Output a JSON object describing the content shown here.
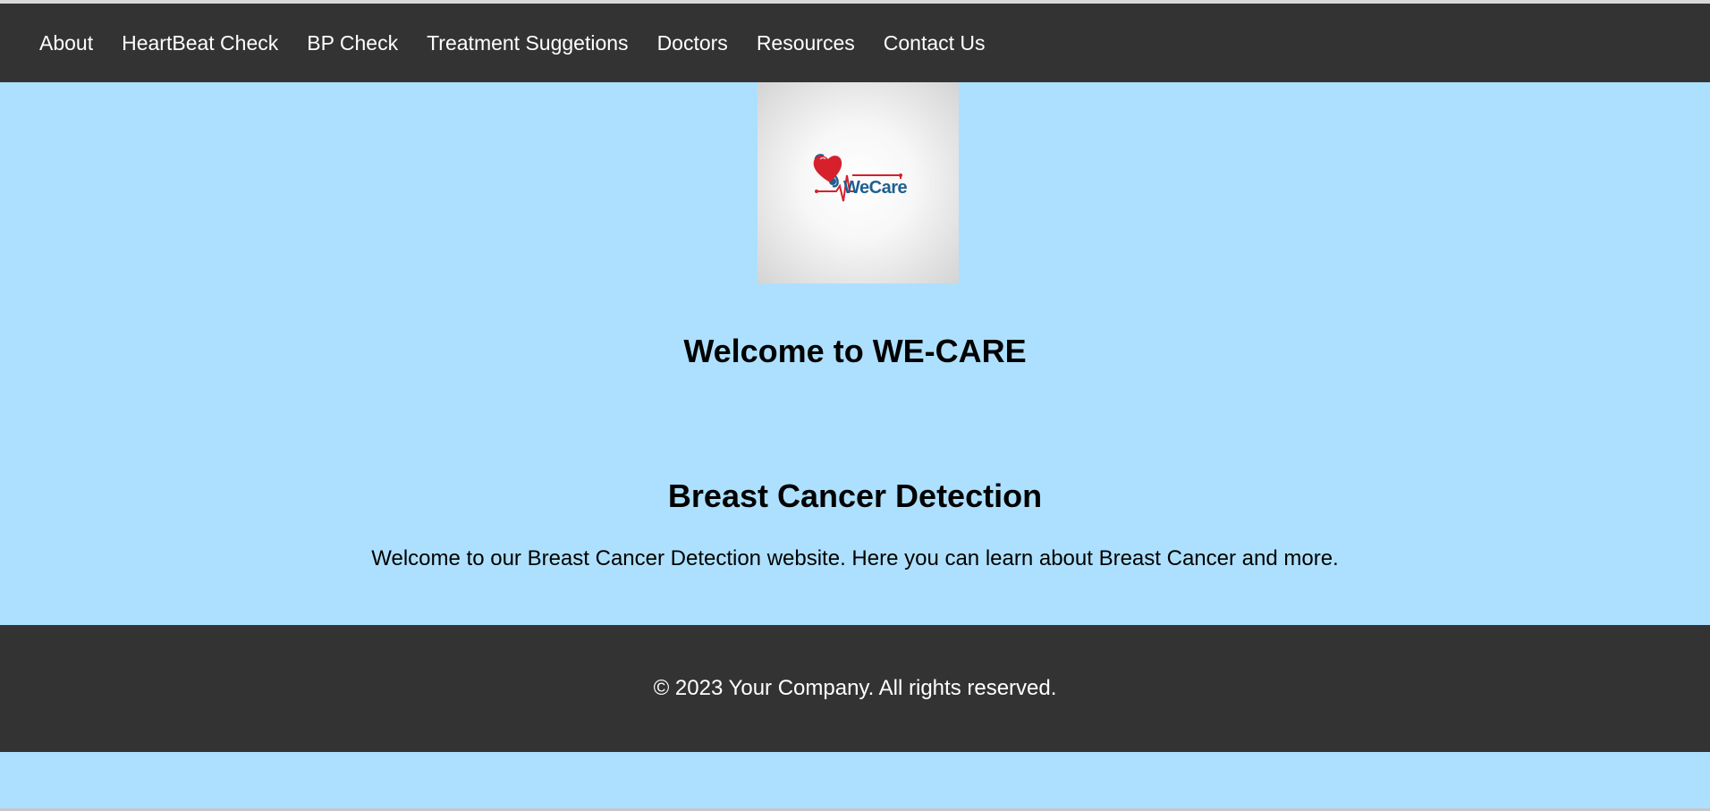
{
  "nav": {
    "items": [
      {
        "label": "About"
      },
      {
        "label": "HeartBeat Check"
      },
      {
        "label": "BP Check"
      },
      {
        "label": "Treatment Suggetions"
      },
      {
        "label": "Doctors"
      },
      {
        "label": "Resources"
      },
      {
        "label": "Contact Us"
      }
    ]
  },
  "logo": {
    "text": "WeCare",
    "icon": "heart-stethoscope-icon"
  },
  "main": {
    "welcome_title": "Welcome to WE-CARE",
    "section_title": "Breast Cancer Detection",
    "section_text": "Welcome to our Breast Cancer Detection website. Here you can learn about Breast Cancer and more."
  },
  "footer": {
    "text": "© 2023 Your Company. All rights reserved."
  },
  "colors": {
    "page_background": "#ade0fe",
    "nav_background": "#333333",
    "footer_background": "#333333",
    "logo_red": "#d6202c",
    "logo_blue": "#1f5f8f"
  }
}
